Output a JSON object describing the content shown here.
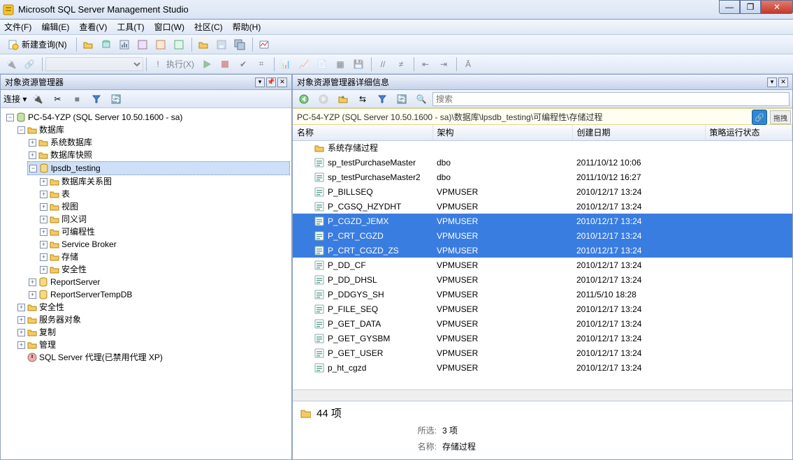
{
  "app": {
    "title": "Microsoft SQL Server Management Studio"
  },
  "menu": [
    "文件(F)",
    "编辑(E)",
    "查看(V)",
    "工具(T)",
    "窗口(W)",
    "社区(C)",
    "帮助(H)"
  ],
  "toolbar1": {
    "new_query": "新建查询(N)"
  },
  "toolbar2": {
    "execute": "执行(X)"
  },
  "left": {
    "panel_title": "对象资源管理器",
    "connect_label": "连接 ▾",
    "root": "PC-54-YZP (SQL Server 10.50.1600 - sa)",
    "db_folder": "数据库",
    "sys_db": "系统数据库",
    "db_snap": "数据库快照",
    "db_name": "lpsdb_testing",
    "diagram": "数据库关系图",
    "tables": "表",
    "views": "视图",
    "synonyms": "同义词",
    "programmability": "可编程性",
    "service_broker": "Service Broker",
    "storage": "存储",
    "security_db": "安全性",
    "report_server": "ReportServer",
    "report_server_temp": "ReportServerTempDB",
    "security": "安全性",
    "server_objects": "服务器对象",
    "replication": "复制",
    "management": "管理",
    "agent": "SQL Server 代理(已禁用代理 XP)"
  },
  "right": {
    "panel_title": "对象资源管理器详细信息",
    "search_placeholder": "搜索",
    "breadcrumb": "PC-54-YZP (SQL Server 10.50.1600 - sa)\\数据库\\lpsdb_testing\\可编程性\\存储过程",
    "drag_label": "拖拽",
    "cols": {
      "name": "名称",
      "schema": "架构",
      "created": "创建日期",
      "policy": "策略运行状态"
    },
    "rows": [
      {
        "icon": "folder",
        "name": "系统存储过程",
        "schema": "",
        "created": "",
        "sel": false
      },
      {
        "icon": "sp",
        "name": "sp_testPurchaseMaster",
        "schema": "dbo",
        "created": "2011/10/12 10:06",
        "sel": false
      },
      {
        "icon": "sp",
        "name": "sp_testPurchaseMaster2",
        "schema": "dbo",
        "created": "2011/10/12 16:27",
        "sel": false
      },
      {
        "icon": "sp",
        "name": "P_BILLSEQ",
        "schema": "VPMUSER",
        "created": "2010/12/17 13:24",
        "sel": false
      },
      {
        "icon": "sp",
        "name": "P_CGSQ_HZYDHT",
        "schema": "VPMUSER",
        "created": "2010/12/17 13:24",
        "sel": false
      },
      {
        "icon": "sp",
        "name": "P_CGZD_JEMX",
        "schema": "VPMUSER",
        "created": "2010/12/17 13:24",
        "sel": true
      },
      {
        "icon": "sp",
        "name": "P_CRT_CGZD",
        "schema": "VPMUSER",
        "created": "2010/12/17 13:24",
        "sel": true
      },
      {
        "icon": "sp",
        "name": "P_CRT_CGZD_ZS",
        "schema": "VPMUSER",
        "created": "2010/12/17 13:24",
        "sel": true
      },
      {
        "icon": "sp",
        "name": "P_DD_CF",
        "schema": "VPMUSER",
        "created": "2010/12/17 13:24",
        "sel": false
      },
      {
        "icon": "sp",
        "name": "P_DD_DHSL",
        "schema": "VPMUSER",
        "created": "2010/12/17 13:24",
        "sel": false
      },
      {
        "icon": "sp",
        "name": "P_DDGYS_SH",
        "schema": "VPMUSER",
        "created": "2011/5/10 18:28",
        "sel": false
      },
      {
        "icon": "sp",
        "name": "P_FILE_SEQ",
        "schema": "VPMUSER",
        "created": "2010/12/17 13:24",
        "sel": false
      },
      {
        "icon": "sp",
        "name": "P_GET_DATA",
        "schema": "VPMUSER",
        "created": "2010/12/17 13:24",
        "sel": false
      },
      {
        "icon": "sp",
        "name": "P_GET_GYSBM",
        "schema": "VPMUSER",
        "created": "2010/12/17 13:24",
        "sel": false
      },
      {
        "icon": "sp",
        "name": "P_GET_USER",
        "schema": "VPMUSER",
        "created": "2010/12/17 13:24",
        "sel": false
      },
      {
        "icon": "sp",
        "name": "p_ht_cgzd",
        "schema": "VPMUSER",
        "created": "2010/12/17 13:24",
        "sel": false
      }
    ],
    "summary": {
      "count_text": "44 项",
      "sel_label": "所选:",
      "sel_value": "3 项",
      "name_label": "名称:",
      "name_value": "存储过程"
    }
  }
}
